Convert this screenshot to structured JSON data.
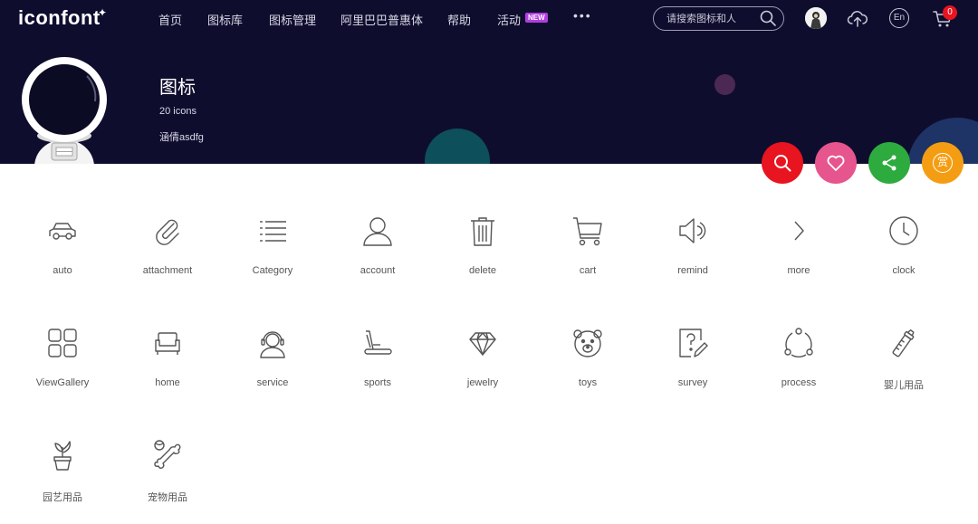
{
  "nav": {
    "logo": "iconfont",
    "items": [
      "首页",
      "图标库",
      "图标管理",
      "阿里巴巴普惠体",
      "帮助",
      "活动"
    ],
    "new_badge": "NEW",
    "more": "•••",
    "search_placeholder": "请搜索图标和人",
    "lang": "En",
    "cart_count": "0"
  },
  "project": {
    "title": "图标",
    "count": "20 icons",
    "owner": "涵倩asdfg"
  },
  "actions": {
    "search_color": "#e8141f",
    "like_color": "#e6558d",
    "share_color": "#2dab3e",
    "reward_color": "#f59d12",
    "reward_glyph": "赏"
  },
  "colors": {
    "header_bg": "#0f0d2e",
    "icon_stroke": "#555555"
  },
  "icons": [
    {
      "label": "auto",
      "icon": "car-icon"
    },
    {
      "label": "attachment",
      "icon": "paperclip-icon"
    },
    {
      "label": "Category",
      "icon": "list-icon"
    },
    {
      "label": "account",
      "icon": "user-icon"
    },
    {
      "label": "delete",
      "icon": "trash-icon"
    },
    {
      "label": "cart",
      "icon": "cart-icon"
    },
    {
      "label": "remind",
      "icon": "speaker-icon"
    },
    {
      "label": "more",
      "icon": "chevron-right-icon"
    },
    {
      "label": "clock",
      "icon": "clock-icon"
    },
    {
      "label": "ViewGallery",
      "icon": "grid-icon"
    },
    {
      "label": "home",
      "icon": "sofa-icon"
    },
    {
      "label": "service",
      "icon": "headset-icon"
    },
    {
      "label": "sports",
      "icon": "treadmill-icon"
    },
    {
      "label": "jewelry",
      "icon": "diamond-icon"
    },
    {
      "label": "toys",
      "icon": "bear-icon"
    },
    {
      "label": "survey",
      "icon": "survey-icon"
    },
    {
      "label": "process",
      "icon": "process-icon"
    },
    {
      "label": "婴儿用品",
      "icon": "baby-bottle-icon"
    },
    {
      "label": "园艺用品",
      "icon": "plant-icon"
    },
    {
      "label": "宠物用品",
      "icon": "bone-icon"
    }
  ]
}
